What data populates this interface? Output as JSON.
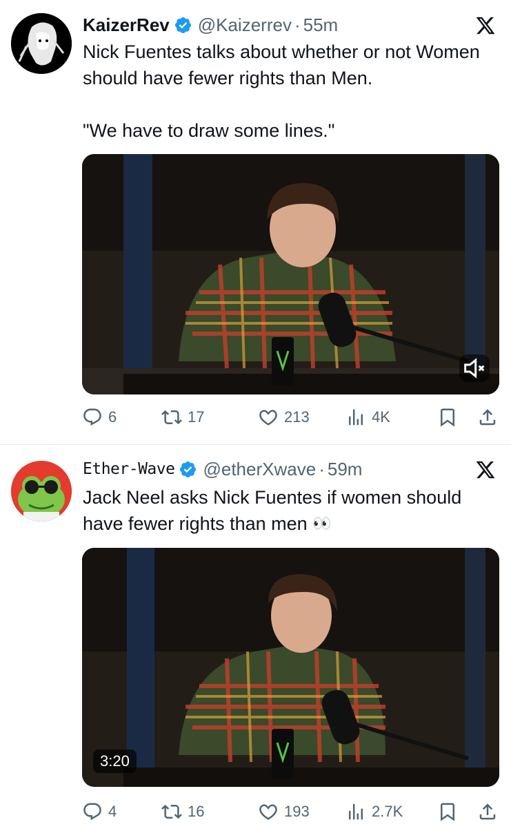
{
  "tweets": [
    {
      "display_name": "KaizerRev",
      "handle": "@Kaizerrev",
      "separator": "·",
      "time": "55m",
      "text_line_1": "Nick Fuentes talks about whether or not Women should have fewer rights than Men.",
      "text_line_2": "\"We have to draw some lines.\"",
      "media_caption": "",
      "stats": {
        "replies": "6",
        "retweets": "17",
        "likes": "213",
        "views": "4K"
      }
    },
    {
      "display_name": "Ether-Wave",
      "handle": "@etherXwave",
      "separator": "·",
      "time": "59m",
      "text_line_1": "Jack Neel asks Nick Fuentes if women should have fewer rights than men",
      "emoji": "👀",
      "video_duration": "3:20",
      "stats": {
        "replies": "4",
        "retweets": "16",
        "likes": "193",
        "views": "2.7K"
      }
    }
  ],
  "icons": {
    "verified": "verified-badge-icon",
    "platform": "x-logo-icon",
    "reply": "reply-icon",
    "retweet": "retweet-icon",
    "like": "like-icon",
    "views": "views-icon",
    "bookmark": "bookmark-icon",
    "share": "share-icon",
    "mute": "mute-icon"
  },
  "colors": {
    "verified_blue": "#1d9bf0",
    "text_primary": "#0f1419",
    "text_secondary": "#536471",
    "divider": "#e6ecf0"
  }
}
